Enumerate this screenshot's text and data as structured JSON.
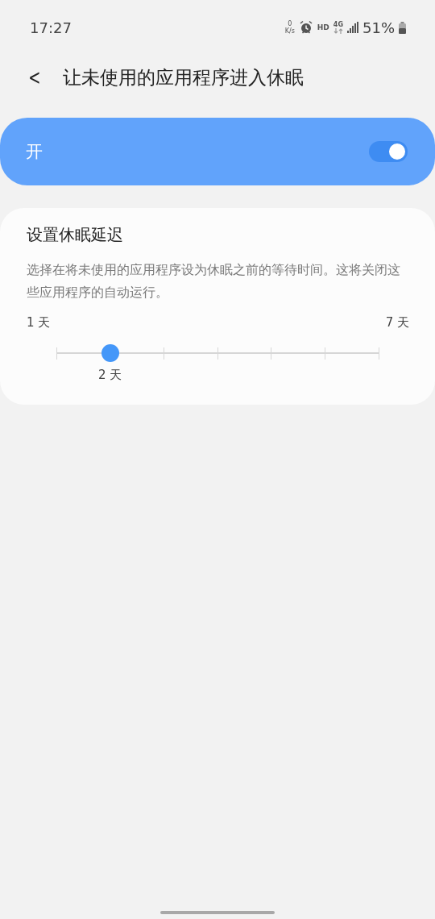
{
  "status_bar": {
    "time": "17:27",
    "speed_value": "0",
    "speed_unit": "K/s",
    "hd": "HD",
    "network": "4G",
    "battery": "51%"
  },
  "header": {
    "back": "<",
    "title": "让未使用的应用程序进入休眠"
  },
  "master_switch": {
    "label": "开",
    "on": true
  },
  "delay_card": {
    "title": "设置休眠延迟",
    "description": "选择在将未使用的应用程序设为休眠之前的等待时间。这将关闭这些应用程序的自动运行。",
    "min_label": "1 天",
    "max_label": "7 天",
    "value_label": "2 天",
    "level": 0.1667
  }
}
